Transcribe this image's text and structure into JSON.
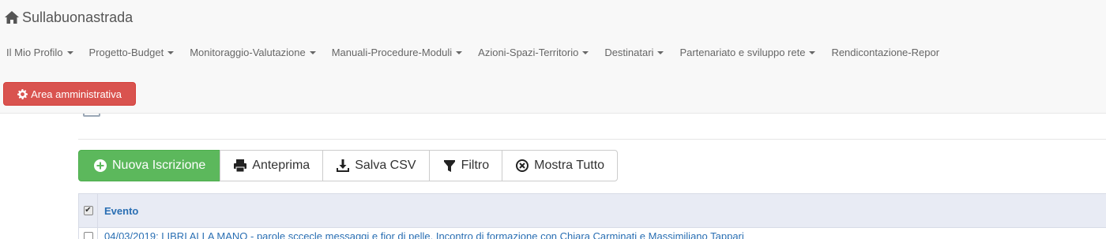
{
  "brand": {
    "name": "Sullabuonastrada",
    "icon": "home-icon"
  },
  "nav": {
    "items": [
      {
        "label": "Il Mio Profilo",
        "dropdown": true
      },
      {
        "label": "Progetto-Budget",
        "dropdown": true
      },
      {
        "label": "Monitoraggio-Valutazione",
        "dropdown": true
      },
      {
        "label": "Manuali-Procedure-Moduli",
        "dropdown": true
      },
      {
        "label": "Azioni-Spazi-Territorio",
        "dropdown": true
      },
      {
        "label": "Destinatari",
        "dropdown": true
      },
      {
        "label": "Partenariato e sviluppo rete",
        "dropdown": true
      },
      {
        "label": "Rendicontazione-Repor",
        "dropdown": false
      }
    ],
    "admin_button": {
      "label": "Area amministrativa",
      "icon": "gear-icon",
      "color": "#d9534f"
    }
  },
  "toolbar": {
    "new": {
      "label": "Nuova Iscrizione",
      "icon": "plus-circle-icon",
      "color": "#5cb85c"
    },
    "preview": {
      "label": "Anteprima",
      "icon": "print-icon"
    },
    "csv": {
      "label": "Salva CSV",
      "icon": "download-icon"
    },
    "filter": {
      "label": "Filtro",
      "icon": "filter-icon"
    },
    "show_all": {
      "label": "Mostra Tutto",
      "icon": "times-circle-icon"
    }
  },
  "table": {
    "header": {
      "column": "Evento",
      "checked": true
    },
    "rows": [
      {
        "text": "04/03/2019: LIBRI ALLA MANO - parole sccecle messaggi e fior di pelle. Incontro di formazione con Chiara Carminati e Massimiliano Tappari",
        "checked": false
      }
    ]
  },
  "colors": {
    "link": "#2a6fb3",
    "table_header_bg": "#e8ebf4",
    "navbar_bg": "#f8f8f8"
  }
}
